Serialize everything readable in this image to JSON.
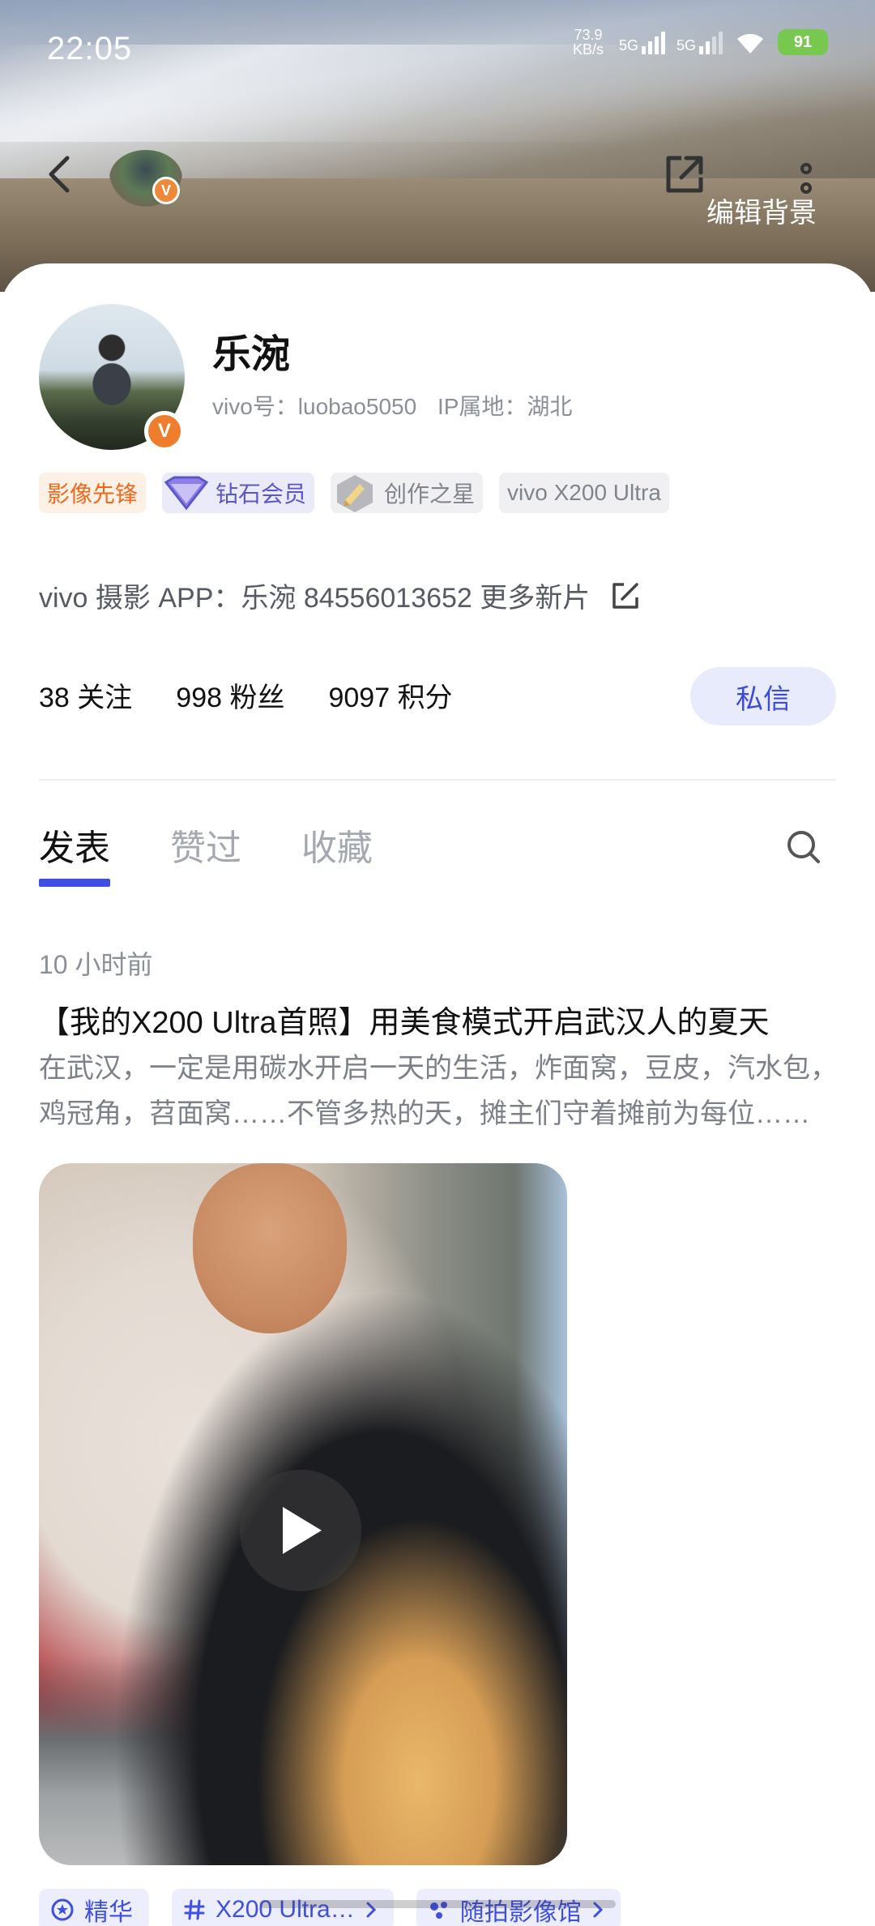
{
  "status_bar": {
    "time": "22:05",
    "net_speed_value": "73.9",
    "net_speed_unit": "KB/s",
    "signal_1": "5G",
    "signal_2": "5G",
    "battery": "91"
  },
  "header": {
    "edit_background_label": "编辑背景",
    "icons": [
      "back-icon",
      "share-icon",
      "more-icon"
    ]
  },
  "profile": {
    "name": "乐涴",
    "vivo_id": "vivo号：luobao5050",
    "ip_location": "IP属地：湖北",
    "avatar_badge": "V",
    "tags": [
      {
        "label": "影像先锋",
        "color": "#ec6a1e"
      },
      {
        "label": "钻石会员",
        "color": "#5b57c9"
      },
      {
        "label": "创作之星",
        "color": "#80848c"
      },
      {
        "label": "vivo X200 Ultra",
        "color": "#80848c"
      }
    ],
    "bio": "vivo 摄影 APP：乐涴  84556013652 更多新片",
    "stats": [
      {
        "value": "38",
        "label": "关注"
      },
      {
        "value": "998",
        "label": "粉丝"
      },
      {
        "value": "9097",
        "label": "积分"
      }
    ],
    "dm_label": "私信"
  },
  "tabs": [
    {
      "label": "发表",
      "active": true
    },
    {
      "label": "赞过",
      "active": false
    },
    {
      "label": "收藏",
      "active": false
    }
  ],
  "post": {
    "time": "10 小时前",
    "title": "【我的X200 Ultra首照】用美食模式开启武汉人的夏天",
    "body": "在武汉，一定是用碳水开启一天的生活，炸面窝，豆皮，汽水包，鸡冠角，苕面窝……不管多热的天，摊主们守着摊前为每位……",
    "tags": [
      {
        "label": "精华",
        "icon": "star-badge-icon"
      },
      {
        "label": "X200 Ultra…",
        "icon": "hashtag-icon"
      },
      {
        "label": "随拍影像馆",
        "icon": "dots-icon"
      }
    ]
  },
  "colors": {
    "accent": "#3f4fe0",
    "accent_soft": "#e8ebfb",
    "badge_orange": "#ee7d2d"
  }
}
